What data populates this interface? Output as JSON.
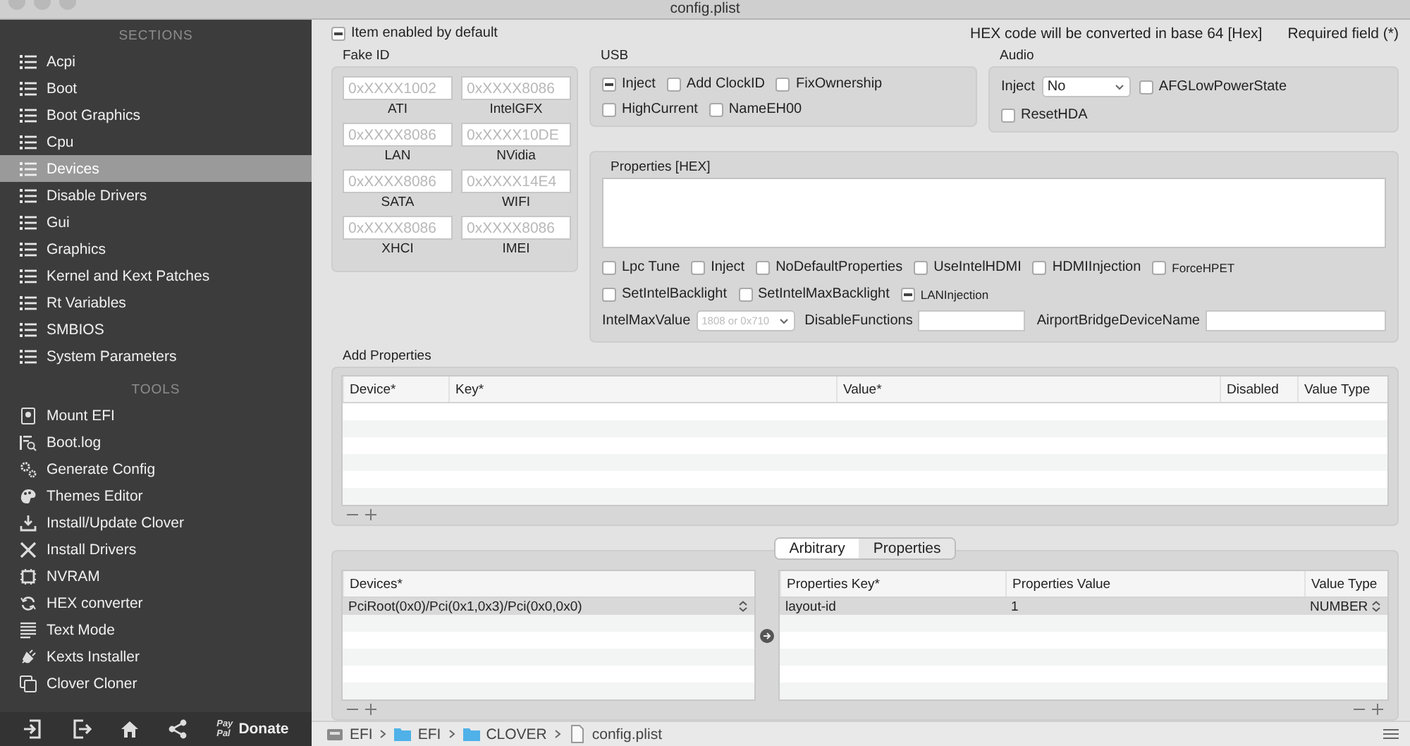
{
  "window": {
    "title": "config.plist"
  },
  "sidebar": {
    "sections_heading": "SECTIONS",
    "sections": [
      {
        "label": "Acpi",
        "selected": false
      },
      {
        "label": "Boot",
        "selected": false
      },
      {
        "label": "Boot Graphics",
        "selected": false
      },
      {
        "label": "Cpu",
        "selected": false
      },
      {
        "label": "Devices",
        "selected": true
      },
      {
        "label": "Disable Drivers",
        "selected": false
      },
      {
        "label": "Gui",
        "selected": false
      },
      {
        "label": "Graphics",
        "selected": false
      },
      {
        "label": "Kernel and Kext Patches",
        "selected": false
      },
      {
        "label": "Rt Variables",
        "selected": false
      },
      {
        "label": "SMBIOS",
        "selected": false
      },
      {
        "label": "System Parameters",
        "selected": false
      }
    ],
    "tools_heading": "TOOLS",
    "tools": [
      {
        "label": "Mount EFI",
        "kind": "disk"
      },
      {
        "label": "Boot.log",
        "kind": "log"
      },
      {
        "label": "Generate Config",
        "kind": "gears"
      },
      {
        "label": "Themes Editor",
        "kind": "palette"
      },
      {
        "label": "Install/Update Clover",
        "kind": "download"
      },
      {
        "label": "Install Drivers",
        "kind": "tools"
      },
      {
        "label": "NVRAM",
        "kind": "chip"
      },
      {
        "label": "HEX converter",
        "kind": "cycle"
      },
      {
        "label": "Text Mode",
        "kind": "lines"
      },
      {
        "label": "Kexts Installer",
        "kind": "plug"
      },
      {
        "label": "Clover Cloner",
        "kind": "copy"
      }
    ],
    "donate": {
      "brand_top": "Pay",
      "brand_bottom": "Pal",
      "label": "Donate"
    }
  },
  "item_enabled": {
    "label": "Item enabled by default",
    "mixed": true
  },
  "hex_note": "HEX code will be converted in base 64 [Hex]",
  "required_note": "Required field (*)",
  "fake_id": {
    "title": "Fake ID",
    "fields": [
      {
        "placeholder": "0xXXXX1002",
        "label": "ATI"
      },
      {
        "placeholder": "0xXXXX8086",
        "label": "IntelGFX"
      },
      {
        "placeholder": "0xXXXX8086",
        "label": "LAN"
      },
      {
        "placeholder": "0xXXXX10DE",
        "label": "NVidia"
      },
      {
        "placeholder": "0xXXXX8086",
        "label": "SATA"
      },
      {
        "placeholder": "0xXXXX14E4",
        "label": "WIFI"
      },
      {
        "placeholder": "0xXXXX8086",
        "label": "XHCI"
      },
      {
        "placeholder": "0xXXXX8086",
        "label": "IMEI"
      }
    ]
  },
  "usb": {
    "title": "USB",
    "options": [
      {
        "label": "Inject",
        "mixed": true
      },
      {
        "label": "Add ClockID",
        "mixed": false
      },
      {
        "label": "FixOwnership",
        "mixed": false
      },
      {
        "label": "HighCurrent",
        "mixed": false
      },
      {
        "label": "NameEH00",
        "mixed": false
      }
    ]
  },
  "audio": {
    "title": "Audio",
    "inject_label": "Inject",
    "inject_value": "No",
    "options": [
      {
        "label": "AFGLowPowerState",
        "mixed": false
      },
      {
        "label": "ResetHDA",
        "mixed": false
      }
    ]
  },
  "properties": {
    "title": "Properties [HEX]",
    "options": [
      {
        "label": "Lpc Tune",
        "mixed": false,
        "small": false
      },
      {
        "label": "Inject",
        "mixed": false,
        "small": false
      },
      {
        "label": "NoDefaultProperties",
        "mixed": false,
        "small": false
      },
      {
        "label": "UseIntelHDMI",
        "mixed": false,
        "small": false
      },
      {
        "label": "HDMIInjection",
        "mixed": false,
        "small": false
      },
      {
        "label": "ForceHPET",
        "mixed": false,
        "small": true
      },
      {
        "label": "SetIntelBacklight",
        "mixed": false,
        "small": false
      },
      {
        "label": "SetIntelMaxBacklight",
        "mixed": false,
        "small": false
      },
      {
        "label": "LANInjection",
        "mixed": true,
        "small": true
      }
    ],
    "intel_max_label": "IntelMaxValue",
    "intel_max_placeholder": "1808 or 0x710",
    "disable_functions_label": "DisableFunctions",
    "airport_label": "AirportBridgeDeviceName"
  },
  "add_properties": {
    "title": "Add Properties",
    "columns": [
      "Device*",
      "Key*",
      "Value*",
      "Disabled",
      "Value Type"
    ]
  },
  "arbitrary": {
    "tabs": [
      {
        "label": "Arbitrary",
        "selected": true
      },
      {
        "label": "Properties",
        "selected": false
      }
    ],
    "devices_column": "Devices*",
    "devices": [
      {
        "label": "PciRoot(0x0)/Pci(0x1,0x3)/Pci(0x0,0x0)",
        "selected": true
      }
    ],
    "prop_columns": [
      "Properties Key*",
      "Properties Value",
      "Value Type"
    ],
    "props": [
      {
        "key": "layout-id",
        "value": "1",
        "type": "NUMBER",
        "selected": true
      }
    ]
  },
  "path_bar": [
    {
      "label": "EFI",
      "kind": "drive"
    },
    {
      "label": "EFI",
      "kind": "folder"
    },
    {
      "label": "CLOVER",
      "kind": "folder"
    },
    {
      "label": "config.plist",
      "kind": "file"
    }
  ]
}
